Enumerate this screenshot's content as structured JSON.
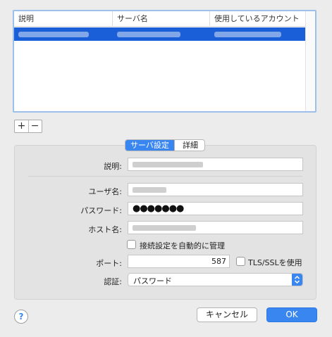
{
  "accounts_table": {
    "columns": [
      "説明",
      "サーバ名",
      "使用しているアカウント"
    ],
    "rows": [
      {
        "selected": true,
        "redacted": true
      }
    ]
  },
  "table_controls": {
    "add_label": "+",
    "remove_label": "−"
  },
  "tabs": [
    {
      "label": "サーバ設定",
      "selected": true
    },
    {
      "label": "詳細",
      "selected": false
    }
  ],
  "form": {
    "description_label": "説明:",
    "username_label": "ユーザ名:",
    "password_label": "パスワード:",
    "password_value": "●●●●●●●",
    "host_label": "ホスト名:",
    "auto_manage_label": "接続設定を自動的に管理",
    "auto_manage_checked": false,
    "port_label": "ポート:",
    "port_value": "587",
    "tls_label": "TLS/SSLを使用",
    "tls_checked": false,
    "auth_label": "認証:",
    "auth_value": "パスワード"
  },
  "footer": {
    "help_label": "?",
    "cancel_label": "キャンセル",
    "ok_label": "OK"
  },
  "colors": {
    "accent": "#3a86f1",
    "selection": "#1a5fd8",
    "window_bg": "#ececec",
    "group_bg": "#e3e3e3"
  }
}
